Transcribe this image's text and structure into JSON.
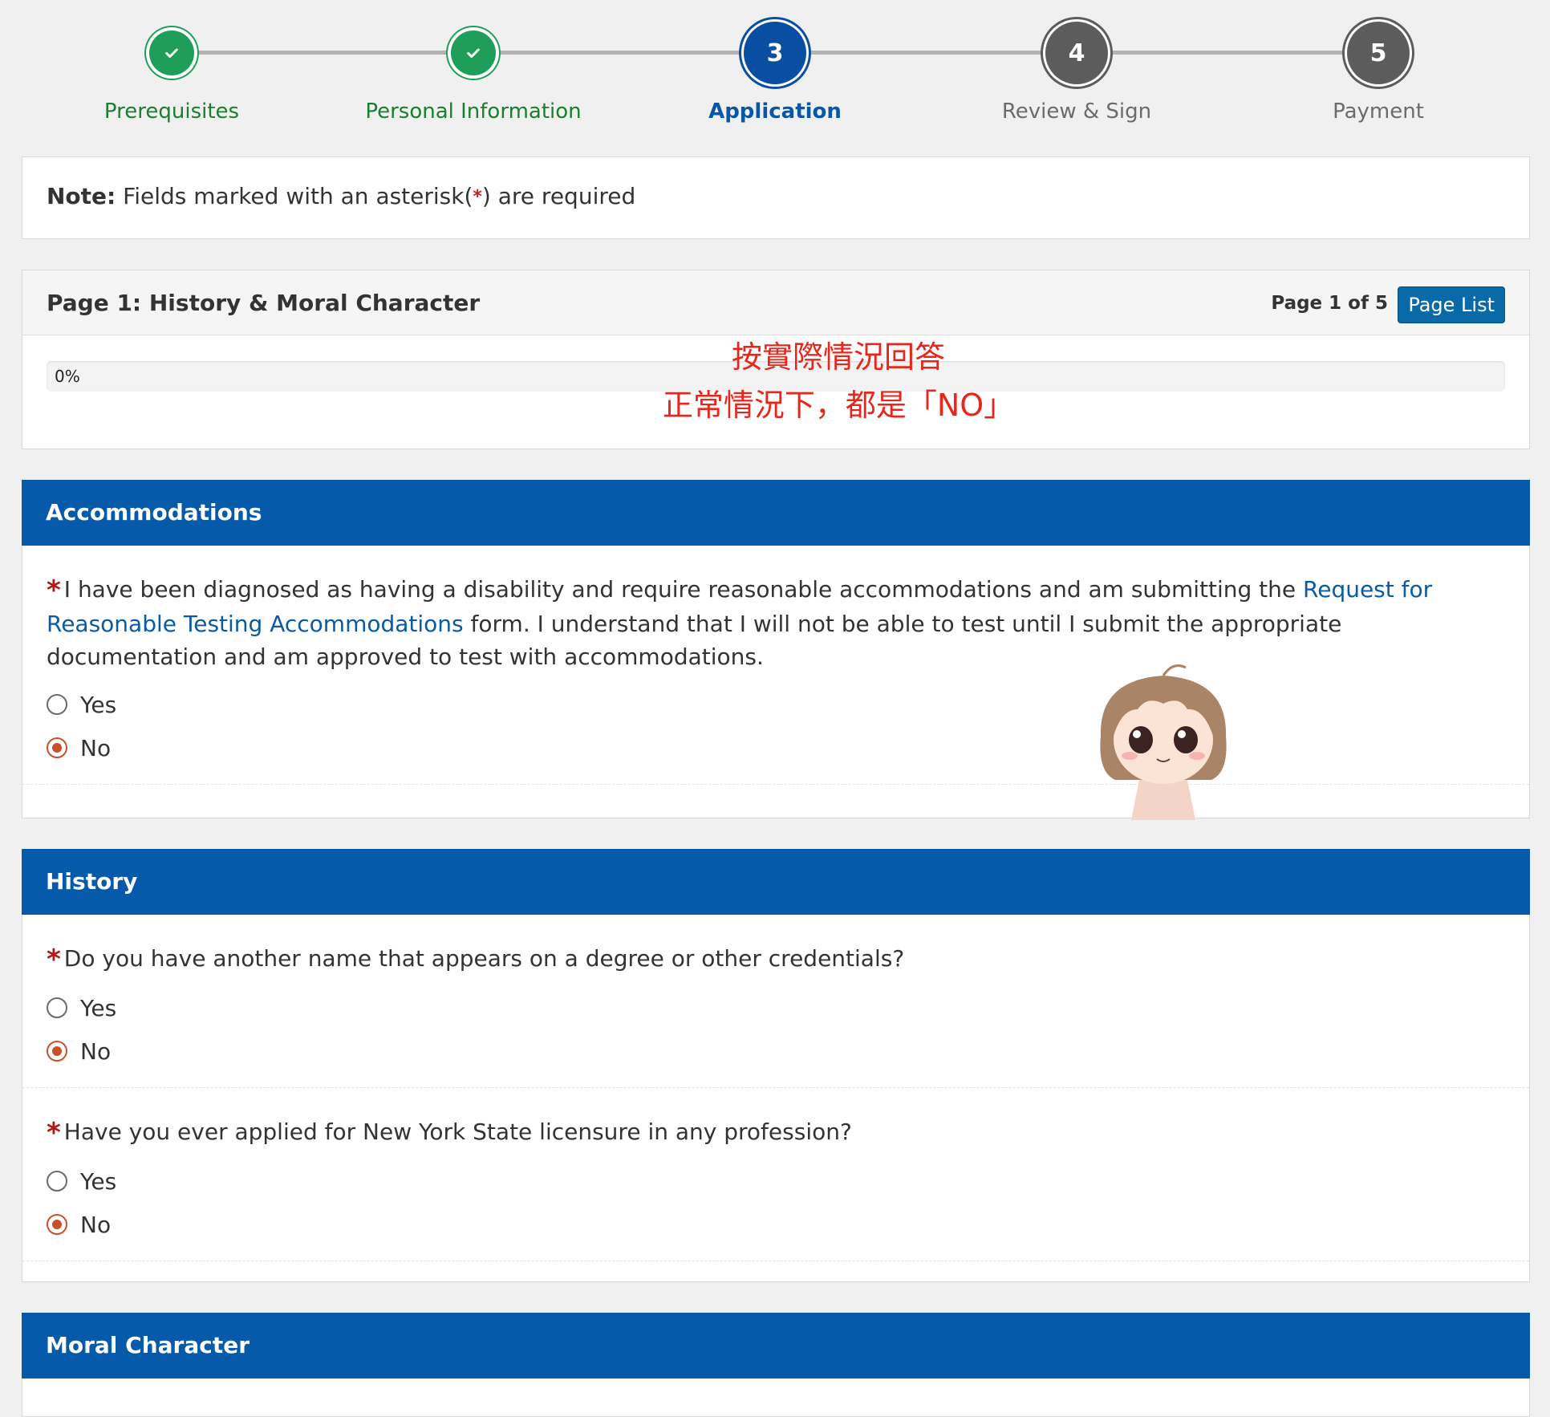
{
  "stepper": {
    "steps": [
      {
        "label": "Prerequisites",
        "state": "done"
      },
      {
        "label": "Personal Information",
        "state": "done"
      },
      {
        "number": "3",
        "label": "Application",
        "state": "current"
      },
      {
        "number": "4",
        "label": "Review & Sign",
        "state": "todo"
      },
      {
        "number": "5",
        "label": "Payment",
        "state": "todo"
      }
    ]
  },
  "note": {
    "bold": "Note:",
    "text_before": " Fields marked with an asterisk(",
    "asterisk": "*",
    "text_after": ") are required"
  },
  "page": {
    "title": "Page 1: History & Moral Character",
    "count": "Page 1 of 5",
    "page_list_label": "Page List",
    "progress_text": "0%",
    "progress_value": 0
  },
  "annotation": {
    "line1": "按實際情況回答",
    "line2": "正常情況下，都是「NO」"
  },
  "sections": {
    "accommodations": {
      "title": "Accommodations",
      "q1": {
        "text_before": "I have been diagnosed as having a disability and require reasonable accommodations and am submitting the ",
        "link_text": "Request for Reasonable Testing Accommodations",
        "text_after": " form. I understand that I will not be able to test until I submit the appropriate documentation and am approved to test with accommodations.",
        "yes_label": "Yes",
        "no_label": "No",
        "selected": "No"
      }
    },
    "history": {
      "title": "History",
      "q1": {
        "text": "Do you have another name that appears on a degree or other credentials?",
        "yes_label": "Yes",
        "no_label": "No",
        "selected": "No"
      },
      "q2": {
        "text": "Have you ever applied for New York State licensure in any profession?",
        "yes_label": "Yes",
        "no_label": "No",
        "selected": "No"
      }
    },
    "moral": {
      "title": "Moral Character"
    }
  },
  "colors": {
    "step_done": "#1f9e5a",
    "step_current": "#0a4ea1",
    "step_todo": "#5c5c5c",
    "section_header": "#075aaa",
    "radio_selected": "#c9512a",
    "annotation": "#e8261c"
  },
  "icons": {
    "step_done": "check-icon"
  }
}
